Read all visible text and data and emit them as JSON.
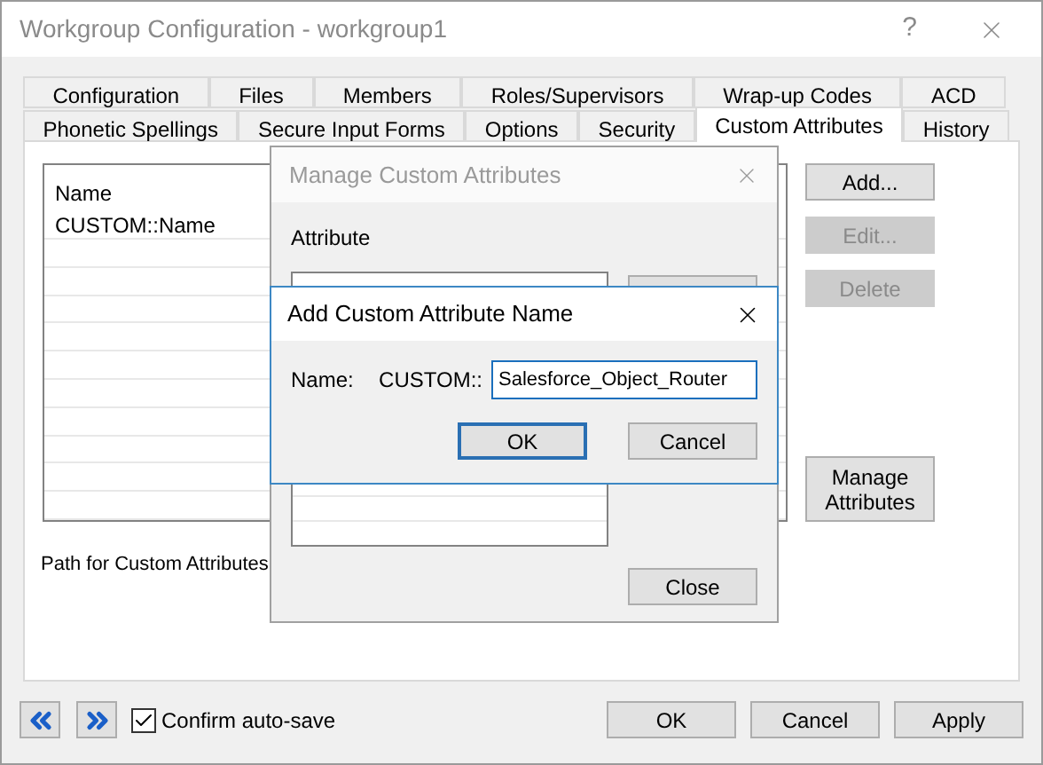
{
  "window": {
    "title": "Workgroup Configuration - workgroup1",
    "help": "?"
  },
  "tab_rows": [
    {
      "tabs": [
        {
          "label": "Configuration",
          "selected": false
        },
        {
          "label": "Files",
          "selected": false
        },
        {
          "label": "Members",
          "selected": false
        },
        {
          "label": "Roles/Supervisors",
          "selected": false
        },
        {
          "label": "Wrap-up Codes",
          "selected": false
        },
        {
          "label": "ACD",
          "selected": false
        }
      ]
    },
    {
      "tabs": [
        {
          "label": "Phonetic Spellings",
          "selected": false
        },
        {
          "label": "Secure Input Forms",
          "selected": false
        },
        {
          "label": "Options",
          "selected": false
        },
        {
          "label": "Security",
          "selected": false
        },
        {
          "label": "Custom Attributes",
          "selected": true
        },
        {
          "label": "History",
          "selected": false
        }
      ]
    }
  ],
  "panel": {
    "list": {
      "header": "Name",
      "items": [
        "CUSTOM::Name"
      ]
    },
    "buttons": [
      {
        "label": "Add...",
        "disabled": false
      },
      {
        "label": "Edit...",
        "disabled": true
      },
      {
        "label": "Delete",
        "disabled": true
      }
    ],
    "manage_button": "Manage Attributes",
    "path_label": "Path for Custom Attributes"
  },
  "footer": {
    "confirm_autosave": {
      "label": "Confirm auto-save",
      "checked": true
    },
    "buttons": [
      "OK",
      "Cancel",
      "Apply"
    ]
  },
  "manage_dialog": {
    "title": "Manage Custom Attributes",
    "section_label": "Attribute",
    "close_button": "Close"
  },
  "add_dialog": {
    "title": "Add Custom Attribute Name",
    "name_label": "Name:",
    "prefix": "CUSTOM::",
    "value": "Salesforce_Object_Router",
    "buttons": [
      {
        "label": "OK",
        "default": true
      },
      {
        "label": "Cancel",
        "default": false
      }
    ]
  }
}
